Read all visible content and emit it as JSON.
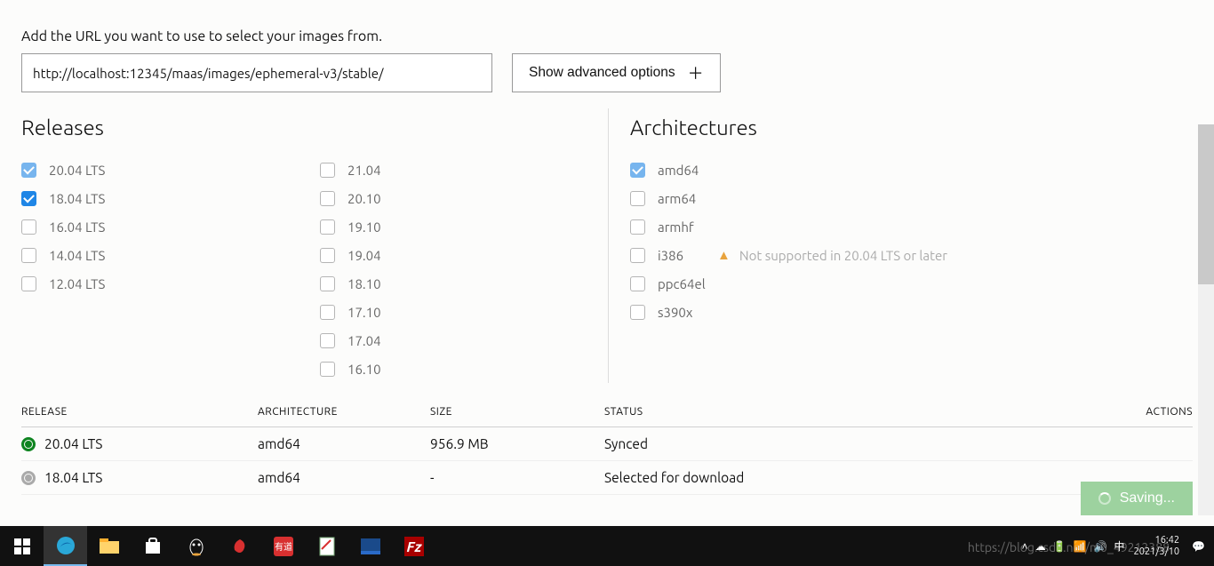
{
  "help_text": "Add the URL you want to use to select your images from.",
  "url_input": {
    "value": "http://localhost:12345/maas/images/ephemeral-v3/stable/"
  },
  "advanced_btn": "Show advanced options",
  "sections": {
    "releases": "Releases",
    "arch": "Architectures"
  },
  "releases_col1": [
    {
      "label": "20.04 LTS",
      "checked": true,
      "faded": true
    },
    {
      "label": "18.04 LTS",
      "checked": true,
      "faded": false
    },
    {
      "label": "16.04 LTS",
      "checked": false,
      "faded": false
    },
    {
      "label": "14.04 LTS",
      "checked": false,
      "faded": false
    },
    {
      "label": "12.04 LTS",
      "checked": false,
      "faded": false
    }
  ],
  "releases_col2": [
    {
      "label": "21.04"
    },
    {
      "label": "20.10"
    },
    {
      "label": "19.10"
    },
    {
      "label": "19.04"
    },
    {
      "label": "18.10"
    },
    {
      "label": "17.10"
    },
    {
      "label": "17.04"
    },
    {
      "label": "16.10"
    }
  ],
  "architectures": [
    {
      "label": "amd64",
      "checked": true,
      "faded": true,
      "warn": null
    },
    {
      "label": "arm64",
      "checked": false,
      "warn": null
    },
    {
      "label": "armhf",
      "checked": false,
      "warn": null
    },
    {
      "label": "i386",
      "checked": false,
      "warn": "Not supported in 20.04 LTS or later"
    },
    {
      "label": "ppc64el",
      "checked": false,
      "warn": null
    },
    {
      "label": "s390x",
      "checked": false,
      "warn": null
    }
  ],
  "table": {
    "headers": {
      "release": "RELEASE",
      "arch": "ARCHITECTURE",
      "size": "SIZE",
      "status": "STATUS",
      "actions": "ACTIONS"
    },
    "rows": [
      {
        "release": "20.04 LTS",
        "arch": "amd64",
        "size": "956.9 MB",
        "status": "Synced",
        "active": true
      },
      {
        "release": "18.04 LTS",
        "arch": "amd64",
        "size": "-",
        "status": "Selected for download",
        "active": false
      }
    ]
  },
  "save_btn": "Saving...",
  "taskbar": {
    "time": "16:42",
    "date": "2021/3/10",
    "watermark": "https://blog.csdn.net/m0_49212388"
  }
}
